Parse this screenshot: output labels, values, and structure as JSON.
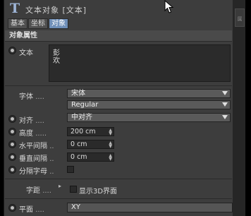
{
  "window": {
    "title": "文本对象 [文本]",
    "tabs": [
      "基本",
      "坐标",
      "对象"
    ],
    "active_tab": "对象"
  },
  "section_title": "对象属性",
  "text_field": {
    "label": "文本",
    "lines": [
      "彭",
      "欢"
    ]
  },
  "font": {
    "label": "字体",
    "dots": "....",
    "family": "宋体",
    "style": "Regular"
  },
  "align": {
    "label": "对齐",
    "dots": "....",
    "value": "中对齐"
  },
  "height": {
    "label": "高度",
    "dots": ".....",
    "value": "200 cm"
  },
  "h_spacing": {
    "label": "水平间隔",
    "dots": "..",
    "value": "0 cm"
  },
  "v_spacing": {
    "label": "垂直间隔",
    "dots": "..",
    "value": "0 cm"
  },
  "separate_letters": {
    "label": "分隔字母",
    "dots": "..",
    "checked": false
  },
  "kerning": {
    "label": "字距",
    "dots": "....",
    "show3d_label": "显示3D界面",
    "show3d_checked": false
  },
  "plane": {
    "label": "平面",
    "dots": "....",
    "value": "XY"
  },
  "side_tab_label": "属"
}
